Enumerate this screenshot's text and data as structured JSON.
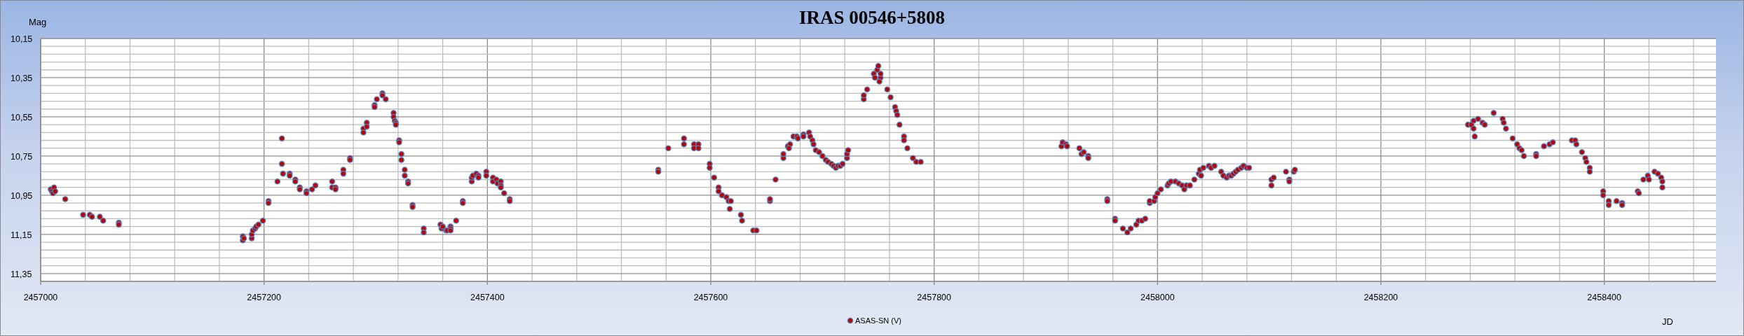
{
  "chart": {
    "chart_data": {
      "type": "scatter",
      "title": "IRAS 00546+5808",
      "xlabel": "JD",
      "ylabel": "Mag",
      "grid": true,
      "xlim": [
        2457000,
        2458500
      ],
      "ylim": [
        11.39,
        10.15
      ],
      "xticks": [
        2457000,
        2457200,
        2457400,
        2457600,
        2457800,
        2458000,
        2458200,
        2458400
      ],
      "yticks": [
        {
          "value": 10.15,
          "label": "10,15"
        },
        {
          "value": 10.35,
          "label": "10,35"
        },
        {
          "value": 10.55,
          "label": "10,55"
        },
        {
          "value": 10.75,
          "label": "10,75"
        },
        {
          "value": 10.95,
          "label": "10,95"
        },
        {
          "value": 11.15,
          "label": "11,15"
        },
        {
          "value": 11.35,
          "label": "11,35"
        }
      ],
      "x": [
        2457009,
        2457010,
        2457011,
        2457012,
        2457013,
        2457022,
        2457038,
        2457044,
        2457046,
        2457053,
        2457056,
        2457070,
        2457070,
        2457181,
        2457181,
        2457182,
        2457189,
        2457189,
        2457190,
        2457192,
        2457193,
        2457195,
        2457199,
        2457204,
        2457204,
        2457212,
        2457216,
        2457216,
        2457217,
        2457223,
        2457223,
        2457228,
        2457228,
        2457232,
        2457232,
        2457238,
        2457238,
        2457243,
        2457246,
        2457261,
        2457261,
        2457264,
        2457264,
        2457271,
        2457271,
        2457277,
        2457277,
        2457289,
        2457289,
        2457292,
        2457292,
        2457299,
        2457299,
        2457301,
        2457306,
        2457306,
        2457309,
        2457316,
        2457316,
        2457317,
        2457318,
        2457318,
        2457321,
        2457321,
        2457323,
        2457323,
        2457326,
        2457326,
        2457329,
        2457329,
        2457333,
        2457333,
        2457343,
        2457343,
        2457358,
        2457359,
        2457360,
        2457363,
        2457364,
        2457367,
        2457367,
        2457367,
        2457372,
        2457378,
        2457378,
        2457386,
        2457386,
        2457387,
        2457390,
        2457392,
        2457392,
        2457399,
        2457399,
        2457405,
        2457405,
        2457408,
        2457409,
        2457412,
        2457412,
        2457412,
        2457415,
        2457420,
        2457420,
        2457553,
        2457553,
        2457562,
        2457576,
        2457576,
        2457585,
        2457585,
        2457589,
        2457589,
        2457599,
        2457599,
        2457603,
        2457607,
        2457607,
        2457610,
        2457614,
        2457616,
        2457618,
        2457617,
        2457627,
        2457628,
        2457638,
        2457641,
        2457653,
        2457653,
        2457658,
        2457665,
        2457665,
        2457669,
        2457671,
        2457670,
        2457674,
        2457677,
        2457678,
        2457683,
        2457683,
        2457688,
        2457689,
        2457691,
        2457692,
        2457694,
        2457697,
        2457700,
        2457703,
        2457705,
        2457708,
        2457710,
        2457712,
        2457714,
        2457716,
        2457718,
        2457722,
        2457722,
        2457723,
        2457737,
        2457737,
        2457740,
        2457746,
        2457747,
        2457749,
        2457750,
        2457752,
        2457752,
        2457751,
        2457758,
        2457761,
        2457765,
        2457766,
        2457767,
        2457769,
        2457773,
        2457773,
        2457776,
        2457781,
        2457784,
        2457788,
        2457914,
        2457915,
        2457918,
        2457919,
        2457930,
        2457932,
        2457934,
        2457938,
        2457938,
        2457955,
        2457955,
        2457962,
        2457962,
        2457969,
        2457973,
        2457976,
        2457981,
        2457983,
        2457986,
        2457989,
        2457993,
        2457993,
        2457997,
        2457998,
        2458000,
        2458003,
        2458009,
        2458010,
        2458012,
        2458016,
        2458019,
        2458022,
        2458024,
        2458026,
        2458029,
        2458033,
        2458037,
        2458038,
        2458039,
        2458041,
        2458046,
        2458048,
        2458051,
        2458057,
        2458059,
        2458062,
        2458064,
        2458066,
        2458068,
        2458070,
        2458072,
        2458075,
        2458077,
        2458080,
        2458082,
        2458102,
        2458104,
        2458102,
        2458115,
        2458118,
        2458118,
        2458122,
        2458123,
        2458278,
        2458281,
        2458283,
        2458283,
        2458284,
        2458287,
        2458291,
        2458293,
        2458301,
        2458309,
        2458310,
        2458312,
        2458318,
        2458322,
        2458324,
        2458326,
        2458328,
        2458339,
        2458339,
        2458346,
        2458351,
        2458354,
        2458371,
        2458374,
        2458375,
        2458380,
        2458383,
        2458384,
        2458387,
        2458387,
        2458399,
        2458399,
        2458404,
        2458404,
        2458411,
        2458416,
        2458416,
        2458430,
        2458431,
        2458435,
        2458439,
        2458440,
        2458445,
        2458448,
        2458451,
        2458452,
        2458452
      ],
      "series": [
        {
          "name": "ASAS-SN (V)",
          "color": "#c00000",
          "values": [
            10.92,
            10.93,
            10.94,
            10.91,
            10.93,
            10.97,
            11.05,
            11.05,
            11.06,
            11.06,
            11.08,
            11.09,
            11.1,
            11.16,
            11.18,
            11.17,
            11.17,
            11.15,
            11.13,
            11.12,
            11.11,
            11.1,
            11.08,
            10.98,
            10.99,
            10.88,
            10.66,
            10.79,
            10.84,
            10.84,
            10.85,
            10.87,
            10.88,
            10.91,
            10.92,
            10.93,
            10.94,
            10.92,
            10.9,
            10.88,
            10.91,
            10.91,
            10.92,
            10.82,
            10.84,
            10.76,
            10.77,
            10.61,
            10.63,
            10.58,
            10.6,
            10.49,
            10.5,
            10.46,
            10.43,
            10.44,
            10.46,
            10.53,
            10.55,
            10.57,
            10.58,
            10.59,
            10.67,
            10.68,
            10.74,
            10.77,
            10.82,
            10.85,
            10.88,
            10.89,
            11.0,
            11.01,
            11.12,
            11.14,
            11.1,
            11.12,
            11.11,
            11.13,
            11.13,
            11.11,
            11.12,
            11.13,
            11.08,
            10.98,
            10.99,
            10.88,
            10.86,
            10.85,
            10.84,
            10.85,
            10.86,
            10.83,
            10.85,
            10.86,
            10.88,
            10.87,
            10.89,
            10.88,
            10.9,
            10.91,
            10.94,
            10.97,
            10.98,
            10.82,
            10.83,
            10.71,
            10.66,
            10.69,
            10.69,
            10.71,
            10.69,
            10.71,
            10.79,
            10.81,
            10.86,
            10.91,
            10.93,
            10.95,
            10.96,
            10.98,
            10.98,
            11.02,
            11.05,
            11.08,
            11.13,
            11.13,
            10.98,
            10.97,
            10.87,
            10.76,
            10.74,
            10.7,
            10.69,
            10.71,
            10.65,
            10.65,
            10.66,
            10.64,
            10.65,
            10.63,
            10.65,
            10.67,
            10.69,
            10.72,
            10.73,
            10.75,
            10.77,
            10.78,
            10.79,
            10.8,
            10.81,
            10.8,
            10.8,
            10.79,
            10.76,
            10.74,
            10.72,
            10.46,
            10.44,
            10.41,
            10.33,
            10.35,
            10.31,
            10.29,
            10.35,
            10.33,
            10.37,
            10.41,
            10.45,
            10.5,
            10.52,
            10.54,
            10.59,
            10.65,
            10.67,
            10.71,
            10.76,
            10.78,
            10.78,
            10.7,
            10.68,
            10.69,
            10.7,
            10.71,
            10.74,
            10.73,
            10.75,
            10.76,
            10.97,
            10.98,
            11.07,
            11.08,
            11.12,
            11.14,
            11.12,
            11.1,
            11.08,
            11.08,
            11.07,
            10.99,
            10.98,
            10.98,
            10.96,
            10.94,
            10.92,
            10.9,
            10.89,
            10.88,
            10.88,
            10.89,
            10.9,
            10.92,
            10.9,
            10.9,
            10.87,
            10.84,
            10.82,
            10.85,
            10.81,
            10.8,
            10.81,
            10.8,
            10.83,
            10.85,
            10.86,
            10.85,
            10.85,
            10.84,
            10.83,
            10.82,
            10.81,
            10.8,
            10.81,
            10.81,
            10.87,
            10.86,
            10.9,
            10.83,
            10.87,
            10.88,
            10.83,
            10.82,
            10.59,
            10.59,
            10.57,
            10.61,
            10.65,
            10.56,
            10.58,
            10.59,
            10.53,
            10.56,
            10.58,
            10.61,
            10.66,
            10.69,
            10.71,
            10.72,
            10.75,
            10.74,
            10.75,
            10.7,
            10.69,
            10.68,
            10.67,
            10.67,
            10.69,
            10.73,
            10.76,
            10.78,
            10.81,
            10.83,
            10.93,
            10.95,
            10.98,
            11.0,
            10.98,
            10.99,
            11.0,
            10.93,
            10.94,
            10.87,
            10.85,
            10.87,
            10.83,
            10.84,
            10.86,
            10.88,
            10.91
          ]
        }
      ]
    }
  }
}
